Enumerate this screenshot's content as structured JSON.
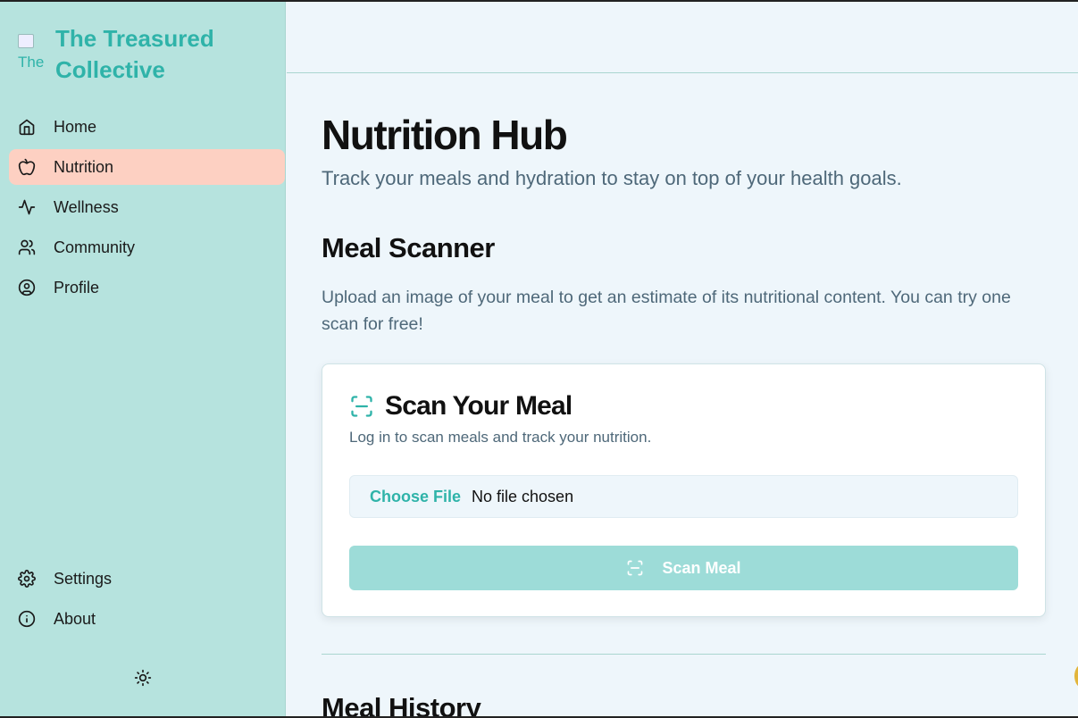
{
  "brand": {
    "name": "The Treasured Collective",
    "logo_alt": "The"
  },
  "nav": {
    "items": [
      {
        "label": "Home",
        "icon": "home-icon"
      },
      {
        "label": "Nutrition",
        "icon": "apple-icon",
        "active": true
      },
      {
        "label": "Wellness",
        "icon": "activity-icon"
      },
      {
        "label": "Community",
        "icon": "users-icon"
      },
      {
        "label": "Profile",
        "icon": "user-circle-icon"
      }
    ],
    "bottom": [
      {
        "label": "Settings",
        "icon": "gear-icon"
      },
      {
        "label": "About",
        "icon": "info-icon"
      }
    ],
    "theme_icon": "sun-icon"
  },
  "page": {
    "title": "Nutrition Hub",
    "subtitle": "Track your meals and hydration to stay on top of your health goals."
  },
  "scanner": {
    "section_title": "Meal Scanner",
    "section_desc": "Upload an image of your meal to get an estimate of its nutritional content. You can try one scan for free!",
    "card_title": "Scan Your Meal",
    "card_icon": "scan-icon",
    "card_desc": "Log in to scan meals and track your nutrition.",
    "file_button": "Choose File",
    "file_status": "No file chosen",
    "scan_button": "Scan Meal"
  },
  "history": {
    "title": "Meal History"
  },
  "colors": {
    "sidebar_bg": "#b6e3de",
    "accent": "#2fb3a9",
    "active_nav": "#fdd0c2",
    "page_bg": "#eef6fb",
    "scan_button_bg": "#9ddcd8"
  }
}
